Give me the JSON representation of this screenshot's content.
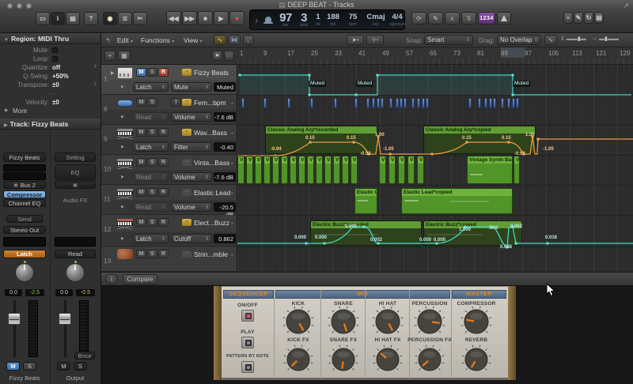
{
  "window": {
    "title": "DEEP BEAT - Tracks"
  },
  "control_bar": {
    "left_buttons": [
      {
        "name": "main-window",
        "glyph": "▭"
      },
      {
        "name": "inspector",
        "glyph": "i",
        "state": "on"
      },
      {
        "name": "display",
        "glyph": "▤"
      },
      {
        "name": "quick-help",
        "glyph": "?"
      },
      {
        "name": "smart-controls",
        "glyph": "◉",
        "state": "on"
      },
      {
        "name": "mixer",
        "glyph": "≣"
      },
      {
        "name": "editors",
        "glyph": "✂"
      }
    ],
    "transport": [
      {
        "name": "rewind",
        "glyph": "◀◀"
      },
      {
        "name": "forward",
        "glyph": "▶▶"
      },
      {
        "name": "stop",
        "glyph": "■"
      },
      {
        "name": "play",
        "glyph": "▶"
      },
      {
        "name": "record",
        "glyph": "●",
        "state": "record"
      }
    ],
    "lcd": {
      "fields": [
        {
          "value": "97",
          "label": "bar",
          "big": true
        },
        {
          "value": "3",
          "label": "beat",
          "big": true
        },
        {
          "value": "1",
          "label": "div"
        },
        {
          "value": "188",
          "label": "tick"
        },
        {
          "value": "75",
          "label": "bpm"
        },
        {
          "value": "Cmaj",
          "label": "key"
        },
        {
          "value": "4/4",
          "label": "signature"
        }
      ]
    },
    "mode_buttons": [
      {
        "name": "cycle",
        "glyph": "⟳"
      },
      {
        "name": "autopunch",
        "glyph": "✎"
      },
      {
        "name": "replace",
        "glyph": "x"
      },
      {
        "name": "solo",
        "glyph": "S"
      }
    ],
    "count_in": "1234",
    "right_buttons": [
      {
        "name": "list-editors",
        "glyph": "≡"
      },
      {
        "name": "note-pads",
        "glyph": "✎"
      },
      {
        "name": "apple-loops",
        "glyph": "↻"
      },
      {
        "name": "browsers",
        "glyph": "▤"
      }
    ]
  },
  "track_toolbar": {
    "edit": "Edit",
    "functions": "Functions",
    "view": "View",
    "snap_label": "Snap:",
    "snap_value": "Smart",
    "drag_label": "Drag:",
    "drag_value": "No Overlap"
  },
  "ruler": {
    "numbers": [
      "1",
      "9",
      "17",
      "25",
      "33",
      "41",
      "49",
      "57",
      "65",
      "73",
      "81",
      "89",
      "97",
      "105",
      "113",
      "121",
      "129"
    ]
  },
  "labels": {
    "m": "M",
    "s": "S",
    "r": "R",
    "i": "I"
  },
  "inspector": {
    "region_header": "Region: MIDI Thru",
    "params": [
      {
        "label": "Mute:",
        "value": "",
        "type": "check"
      },
      {
        "label": "Loop:",
        "value": "",
        "type": "check"
      },
      {
        "label": "Quantize:",
        "value": "off",
        "type": "stepper"
      },
      {
        "label": "Q-Swing:",
        "value": "+50%",
        "type": "plain"
      },
      {
        "label": "Transpose:",
        "value": "±0",
        "type": "stepper"
      },
      {
        "label": "",
        "value": "- -",
        "type": "dashes"
      },
      {
        "label": "Velocity:",
        "value": "±0",
        "type": "plain"
      }
    ],
    "more": "More",
    "track_header": "Track:  Fizzy Beats",
    "strip_left": {
      "name": "Fizzy Beats",
      "bus": "Bus 2",
      "insert1": "Compressor",
      "insert2": "Channel EQ",
      "send": "Send",
      "output": "Stereo Out",
      "automation": "Latch",
      "pan": "0.0",
      "gain": "-2.5",
      "label": "Fizzy Beats"
    },
    "strip_right": {
      "setting": "Setting",
      "eq": "EQ",
      "audio_fx": "Audio FX",
      "automation": "Read",
      "pan": "0.0",
      "gain": "-0.5",
      "bounce": "Bnce",
      "label": "Output"
    }
  },
  "tracks": [
    {
      "num": "1",
      "name": "Fizzy Beats",
      "icon": "drum",
      "chip": "on",
      "m": true,
      "r_on": true,
      "rbtn": true,
      "selected": true,
      "mode": "Latch",
      "param": "Mute",
      "value": "Muted"
    },
    {
      "num": "8",
      "name": "Fem...bpm",
      "icon": "audio",
      "chip": "on",
      "rbtn": false,
      "ibtn": true,
      "mode": "Read",
      "param": "Volume",
      "value": "-7.6 dB",
      "dim_mode": true
    },
    {
      "num": "9",
      "name": "Wav...Bass",
      "icon": "keys",
      "chip": "on",
      "rbtn": true,
      "mode": "Latch",
      "param": "Filter",
      "value": "-0.40"
    },
    {
      "num": "10",
      "name": "Vinta...Bass",
      "icon": "keys",
      "chip": "off",
      "rbtn": true,
      "mode": "Read",
      "param": "Volume",
      "value": "-7.6 dB",
      "dim_mode": true
    },
    {
      "num": "11",
      "name": "Elastic Lead",
      "icon": "keys",
      "chip": "off",
      "rbtn": true,
      "mode": "Read",
      "param": "Volume",
      "value": "-20.5 dB",
      "dim_mode": true
    },
    {
      "num": "12",
      "name": "Elect...Buzz",
      "icon": "keys2",
      "chip": "on",
      "rbtn": true,
      "mode": "Latch",
      "param": "Cutoff",
      "value": "0.862"
    },
    {
      "num": "13",
      "name": "Strin...mble",
      "icon": "strings",
      "chip": "off",
      "rbtn": true
    }
  ],
  "arrangement": {
    "muted_labels": [
      "Muted",
      "Muted",
      "Muted"
    ],
    "regions": {
      "arp1": "Classic Analog Arp*recorded",
      "arp2": "Classic Analog Arp*copied",
      "vintage": "Vintage Synth Bas",
      "v": "V",
      "elastic1": "Elastic L",
      "elastic2": "Elastic Lead*copied",
      "buzz1": "Electric Buzz*recorded",
      "buzz2": "Electric Buzz*copied"
    },
    "filter_values_left": [
      "-0.94",
      "0.15",
      "0.15",
      "-0.93",
      "1.00",
      "-1.00"
    ],
    "filter_values_right": [
      "0.15",
      "0.15",
      "-0.93",
      "1.00",
      "-1.00"
    ],
    "cutoff_values_left": [
      "0.000",
      "0.000",
      "1.000",
      "0.052"
    ],
    "cutoff_values_right": [
      "0.000",
      "0.000",
      "1.000",
      ".000",
      "0.048",
      "0.962"
    ],
    "cutoff_tail": "0.016",
    "mini_label": "V"
  },
  "smart_controls": {
    "compare": "Compare",
    "info_glyph": "i",
    "sections": {
      "sequencer": "SEQUENCER",
      "mix": "MIX",
      "master": "MASTER"
    },
    "seq_buttons": [
      "ON/OFF",
      "PLAY",
      "PATTERN BY NOTE"
    ],
    "mix_row1": [
      "KICK",
      "SNARE",
      "HI HAT",
      "PERCUSSION"
    ],
    "mix_row2": [
      "KICK FX",
      "SNARE FX",
      "HI HAT FX",
      "PERCUSSION FX"
    ],
    "master_row1": "COMPRESSOR",
    "master_row2": "REVERB"
  }
}
